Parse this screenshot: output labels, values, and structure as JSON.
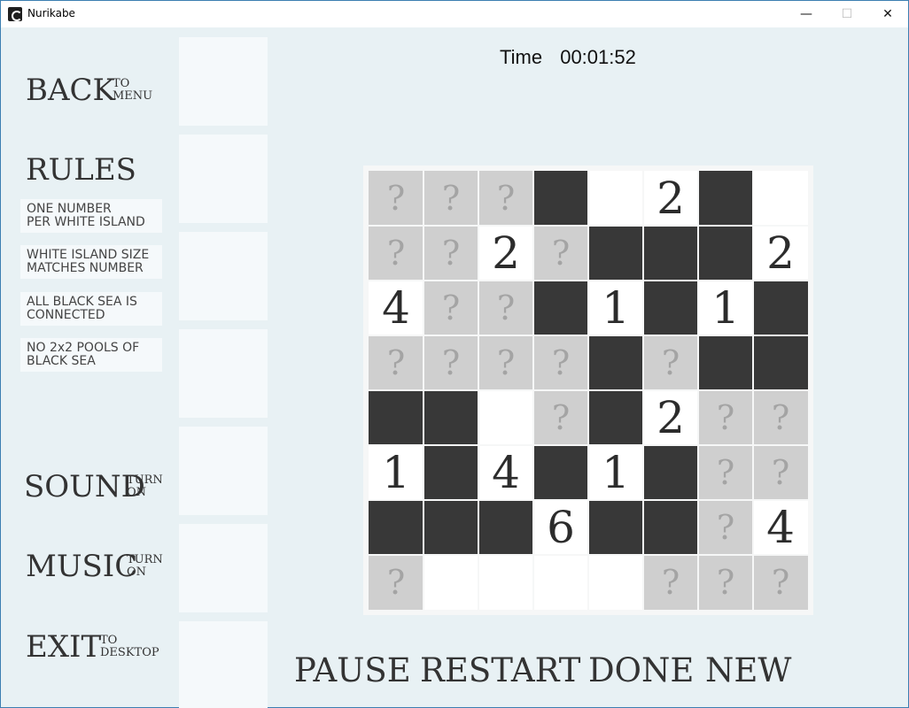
{
  "window": {
    "title": "Nurikabe",
    "minimize_glyph": "—",
    "maximize_glyph": "☐",
    "close_glyph": "✕"
  },
  "timer": {
    "label": "Time",
    "value": "00:01:52"
  },
  "menu": {
    "back": {
      "big": "BACK",
      "small_1": "TO",
      "small_2": "MENU"
    },
    "rules_title": "RULES",
    "rules": [
      {
        "line1": "ONE NUMBER",
        "line2": "PER WHITE ISLAND"
      },
      {
        "line1": "WHITE ISLAND SIZE",
        "line2": "MATCHES NUMBER"
      },
      {
        "line1": "ALL BLACK SEA IS",
        "line2": "CONNECTED"
      },
      {
        "line1": "NO 2x2 POOLS OF",
        "line2": "BLACK SEA"
      }
    ],
    "sound": {
      "big": "SOUND",
      "small_1": "TURN",
      "small_2": "ON"
    },
    "music": {
      "big": "MUSIC",
      "small_1": "TURN",
      "small_2": "ON"
    },
    "exit": {
      "big": "EXIT",
      "small_1": "TO",
      "small_2": "DESKTOP"
    }
  },
  "actions": {
    "pause": "PAUSE",
    "restart": "RESTART",
    "done": "DONE",
    "new": "NEW"
  },
  "board": {
    "size": 8,
    "unknown_glyph": "?",
    "legend": {
      "B": "black",
      "W": "white",
      "?": "unknown",
      "digit": "clue number"
    },
    "rows": [
      [
        "?",
        "?",
        "?",
        "B",
        "W",
        "2",
        "B",
        "W"
      ],
      [
        "?",
        "?",
        "2",
        "?",
        "B",
        "B",
        "B",
        "2"
      ],
      [
        "4",
        "?",
        "?",
        "B",
        "1",
        "B",
        "1",
        "B"
      ],
      [
        "?",
        "?",
        "?",
        "?",
        "B",
        "?",
        "B",
        "B"
      ],
      [
        "B",
        "B",
        "W",
        "?",
        "B",
        "2",
        "?",
        "?"
      ],
      [
        "1",
        "B",
        "4",
        "B",
        "1",
        "B",
        "?",
        "?"
      ],
      [
        "B",
        "B",
        "B",
        "6",
        "B",
        "B",
        "?",
        "4"
      ],
      [
        "?",
        "W",
        "W",
        "W",
        "W",
        "?",
        "?",
        "?"
      ]
    ]
  },
  "colors": {
    "background": "#e8f1f4",
    "panel": "#f5f9fb",
    "black_cell": "#383838",
    "white_cell": "#ffffff",
    "unknown_cell": "#cfcfcf",
    "text": "#333333"
  }
}
